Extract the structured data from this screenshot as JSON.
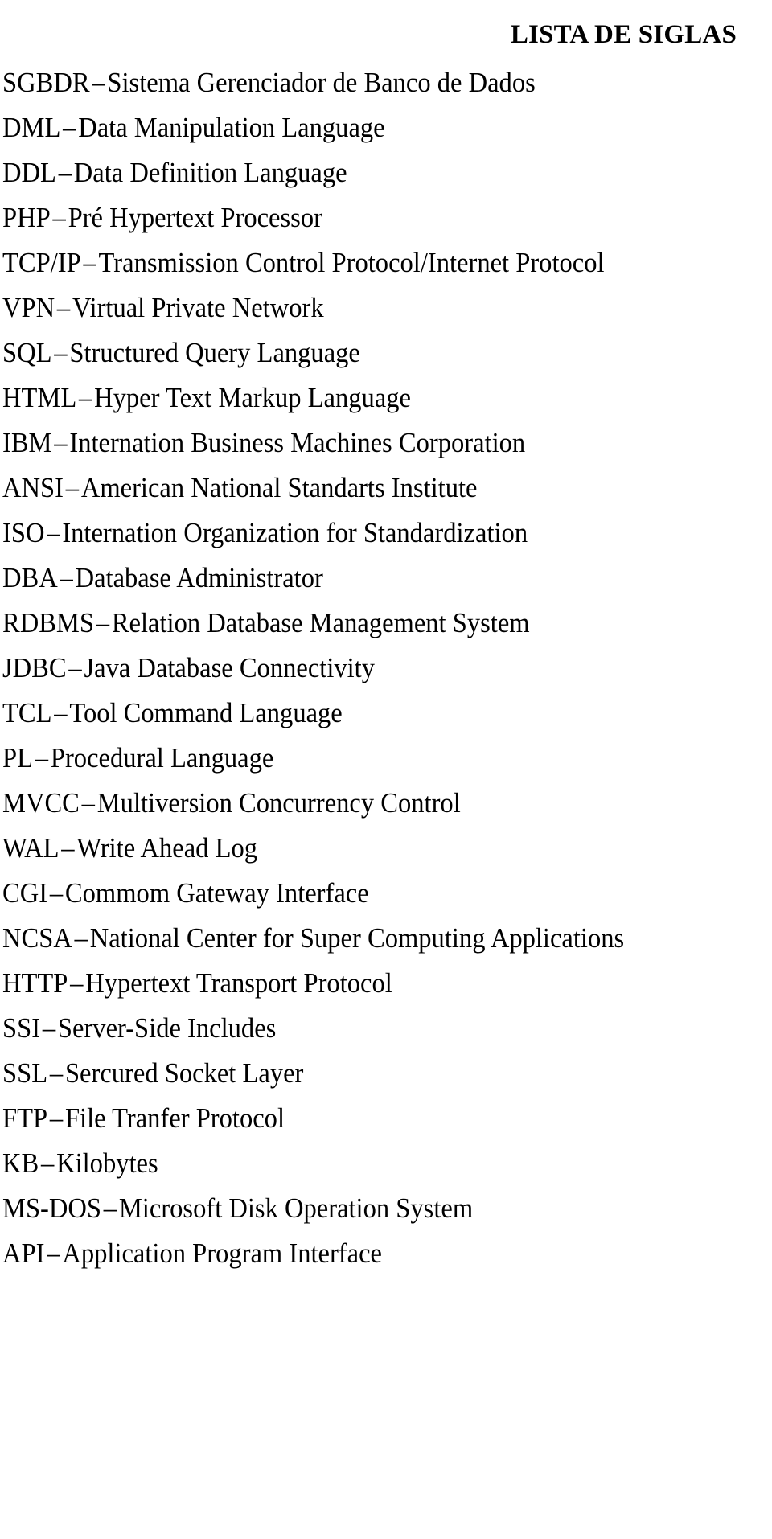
{
  "document": {
    "title": "LISTA DE SIGLAS",
    "separator": "–",
    "entries": [
      {
        "term": "SGBDR",
        "definition": "Sistema Gerenciador de Banco de Dados"
      },
      {
        "term": "DML",
        "definition": "Data Manipulation Language"
      },
      {
        "term": "DDL",
        "definition": "Data Definition Language"
      },
      {
        "term": "PHP",
        "definition": "Pré Hypertext Processor"
      },
      {
        "term": "TCP/IP",
        "definition": "Transmission Control Protocol/Internet Protocol"
      },
      {
        "term": "VPN",
        "definition": "Virtual Private Network"
      },
      {
        "term": "SQL",
        "definition": "Structured Query Language"
      },
      {
        "term": "HTML",
        "definition": "Hyper Text Markup Language"
      },
      {
        "term": "IBM",
        "definition": "Internation Business Machines Corporation"
      },
      {
        "term": "ANSI",
        "definition": "American National Standarts Institute"
      },
      {
        "term": "ISO",
        "definition": "Internation Organization for Standardization"
      },
      {
        "term": "DBA",
        "definition": "Database Administrator"
      },
      {
        "term": "RDBMS",
        "definition": "Relation Database Management System"
      },
      {
        "term": "JDBC",
        "definition": "Java Database Connectivity"
      },
      {
        "term": "TCL",
        "definition": "Tool Command Language"
      },
      {
        "term": "PL",
        "definition": "Procedural Language"
      },
      {
        "term": "MVCC",
        "definition": "Multiversion Concurrency Control"
      },
      {
        "term": "WAL",
        "definition": "Write Ahead Log"
      },
      {
        "term": "CGI",
        "definition": "Commom Gateway Interface"
      },
      {
        "term": "NCSA",
        "definition": "National Center for Super Computing Applications"
      },
      {
        "term": "HTTP",
        "definition": "Hypertext Transport Protocol"
      },
      {
        "term": "SSI",
        "definition": "Server-Side Includes"
      },
      {
        "term": "SSL",
        "definition": "Sercured Socket Layer"
      },
      {
        "term": "FTP",
        "definition": "File Tranfer Protocol"
      },
      {
        "term": "KB",
        "definition": "Kilobytes"
      },
      {
        "term": "MS-DOS",
        "definition": "Microsoft Disk Operation System"
      },
      {
        "term": "API",
        "definition": "Application Program Interface"
      }
    ]
  },
  "style": {
    "text_color": "#000000",
    "background_color": "#ffffff"
  }
}
